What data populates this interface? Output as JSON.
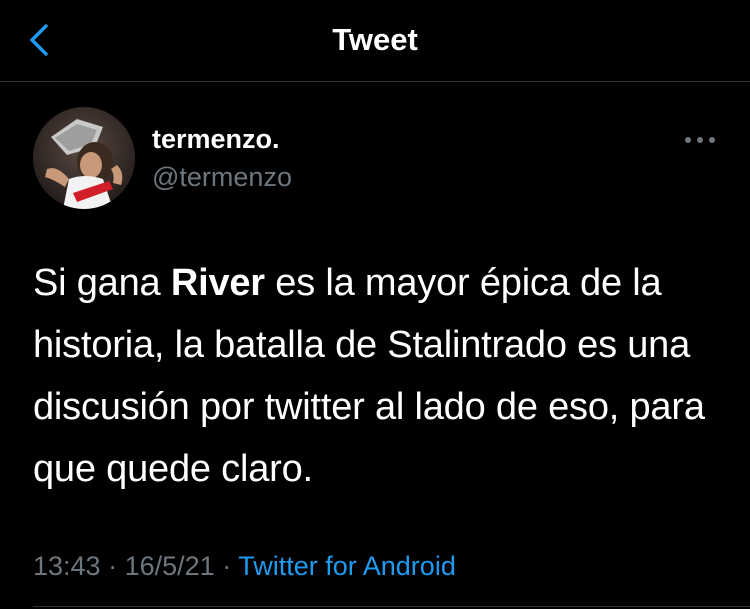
{
  "header": {
    "title": "Tweet",
    "back_icon": "chevron-left-icon"
  },
  "tweet": {
    "author": {
      "display_name": "termenzo.",
      "handle": "@termenzo"
    },
    "text_segments": [
      "Si gana ",
      "River",
      " es la mayor épica de la historia, la batalla de Stalintrado es una discusión por twitter al lado de eso, para que quede claro."
    ],
    "time": "13:43",
    "separator": "·",
    "date": "16/5/21",
    "source": "Twitter for Android"
  },
  "colors": {
    "background": "#000000",
    "accent": "#1d9bf0",
    "secondary_text": "#6e767d"
  }
}
